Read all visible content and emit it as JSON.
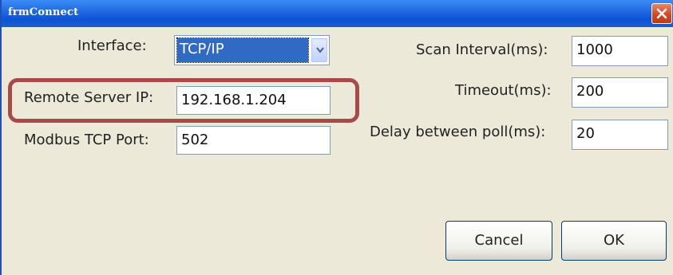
{
  "window": {
    "title": "frmConnect"
  },
  "form": {
    "interface_label": "Interface:",
    "interface_value": "TCP/IP",
    "remote_ip_label": "Remote Server IP:",
    "remote_ip_value": "192.168.1.204",
    "port_label": "Modbus TCP Port:",
    "port_value": "502",
    "scan_interval_label": "Scan Interval(ms):",
    "scan_interval_value": "1000",
    "timeout_label": "Timeout(ms):",
    "timeout_value": "200",
    "delay_label": "Delay between poll(ms):",
    "delay_value": "20"
  },
  "buttons": {
    "cancel": "Cancel",
    "ok": "OK"
  },
  "colors": {
    "titlebar": "#0c54d8",
    "highlight": "#a94a4a",
    "selection": "#316ac5",
    "background": "#ece9d8"
  },
  "icons": {
    "close": "close-icon",
    "dropdown": "chevron-down-icon"
  }
}
